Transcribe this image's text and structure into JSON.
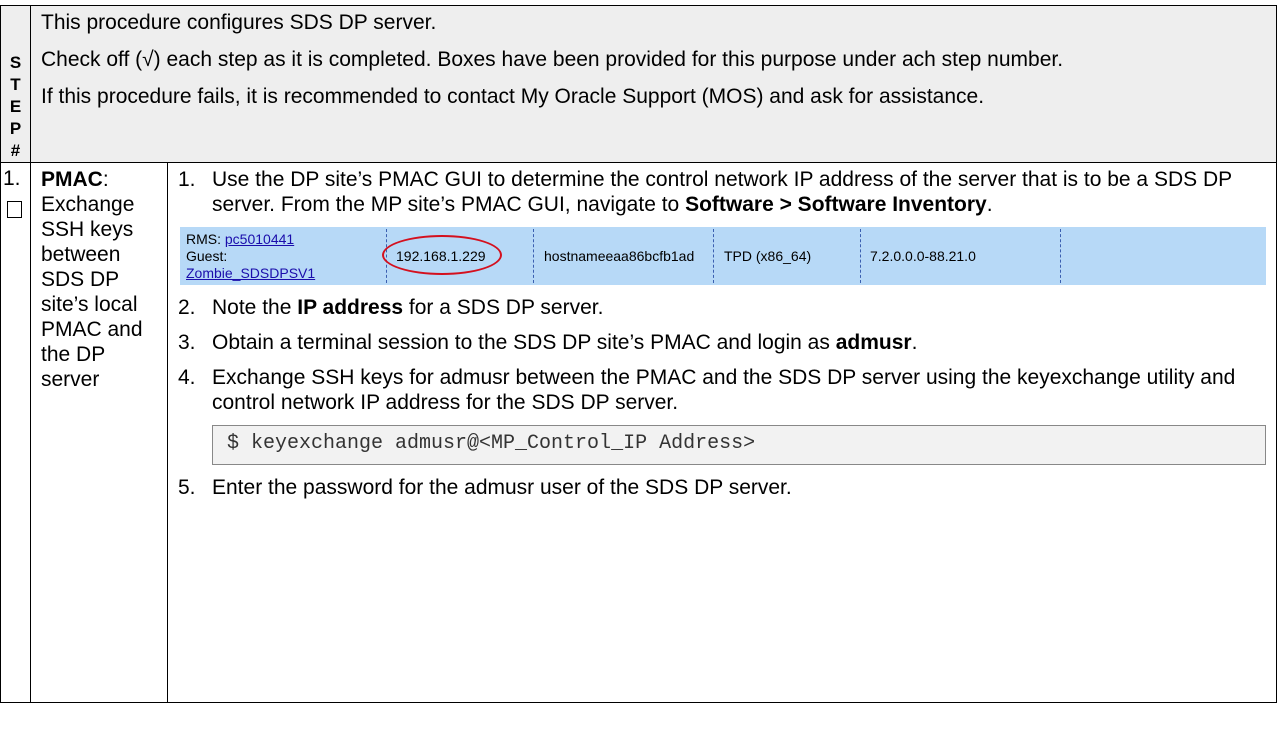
{
  "header": {
    "step_letters": [
      "S",
      "T",
      "E",
      "P",
      "#"
    ],
    "lines": [
      "This procedure configures SDS DP server.",
      "Check off (√) each step as it is completed.  Boxes have been provided for this purpose under ach step number.",
      "If this procedure fails, it is recommended to contact My Oracle Support (MOS) and ask for assistance."
    ]
  },
  "step": {
    "number": "1.",
    "title_bold": "PMAC",
    "title_rest": ":  Exchange SSH keys between SDS DP site’s local PMAC and the DP server",
    "items": [
      {
        "n": "1.",
        "text_before": "Use the DP site’s PMAC GUI to determine the control network IP address of the server that is to be a SDS DP server.  From the MP site’s PMAC GUI, navigate to ",
        "bold": "Software > Software Inventory",
        "text_after": "."
      },
      {
        "n": "2.",
        "text_before": "Note the ",
        "bold": "IP address",
        "text_after": " for a SDS DP server."
      },
      {
        "n": "3.",
        "text_before": "Obtain a terminal session to the SDS DP site’s PMAC and login as ",
        "bold": "admusr",
        "text_after": "."
      },
      {
        "n": "4.",
        "text_before": "Exchange SSH keys for admusr between the PMAC and the SDS DP server using the keyexchange utility and control network IP address for the SDS DP server.",
        "bold": "",
        "text_after": ""
      },
      {
        "n": "5.",
        "text_before": "Enter the password for the admusr user of the SDS DP server.",
        "bold": "",
        "text_after": ""
      }
    ],
    "command": "$ keyexchange admusr@<MP_Control_IP Address>"
  },
  "inventory_row": {
    "rms_label": "RMS: ",
    "rms_link": "pc5010441",
    "guest_label": "Guest:",
    "guest_link": "Zombie_SDSDPSV1",
    "ip": "192.168.1.229",
    "hostname": "hostnameeaa86bcfb1ad",
    "os": "TPD (x86_64)",
    "version": "7.2.0.0.0-88.21.0",
    "highlight_color": "#d4101e",
    "row_color": "#b7d9f7"
  }
}
